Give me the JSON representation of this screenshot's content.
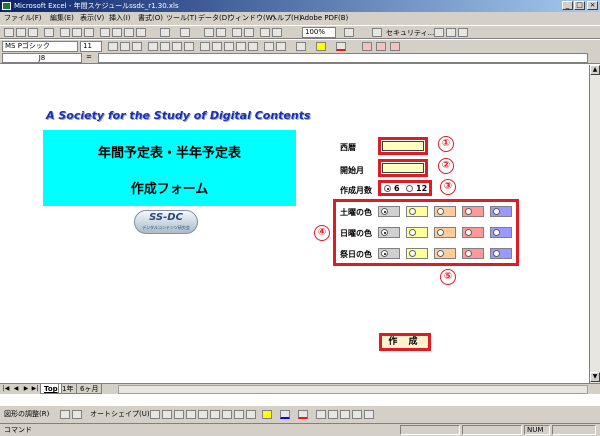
{
  "window": {
    "title": "Microsoft Excel - 年間スケジュールssdc_r1.30.xls"
  },
  "menu": [
    "ファイル(F)",
    "編集(E)",
    "表示(V)",
    "挿入(I)",
    "書式(O)",
    "ツール(T)",
    "データ(D)",
    "ウィンドウ(W)",
    "ヘルプ(H)",
    "Adobe PDF(B)"
  ],
  "toolbar": {
    "zoom": "100%",
    "security": "セキュリティ...",
    "font_name": "MS Pゴシック",
    "font_size": "11"
  },
  "formula_bar": {
    "name_box": "J8",
    "value": ""
  },
  "sheet": {
    "banner": "A Society for the Study of Digital Contents",
    "title_line1": "年間予定表・半年予定表",
    "title_line2": "作成フォーム",
    "logo_text": "SS-DC",
    "logo_subtext": "デジタルコンテンツ研究会",
    "fields": {
      "year_label": "西暦",
      "start_month_label": "開始月",
      "months_label": "作成月数",
      "months_option_a": "6",
      "months_option_b": "12",
      "months_selected": "6"
    },
    "colors": [
      {
        "label": "土曜の色"
      },
      {
        "label": "日曜の色"
      },
      {
        "label": "祭日の色"
      }
    ],
    "swatch_colors": [
      "#d0d0d0",
      "#ffff99",
      "#ffcc99",
      "#ff9999",
      "#9999ff"
    ],
    "create_button": "作 成",
    "callouts": [
      "①",
      "②",
      "③",
      "④",
      "⑤"
    ]
  },
  "sheet_tabs": [
    "Top",
    "1年",
    "6ヶ月"
  ],
  "drawing_toolbar": {
    "draw_menu": "図形の調整(R)",
    "autoshape": "オートシェイプ(U)"
  },
  "status": {
    "left": "コマンド",
    "num": "NUM"
  }
}
